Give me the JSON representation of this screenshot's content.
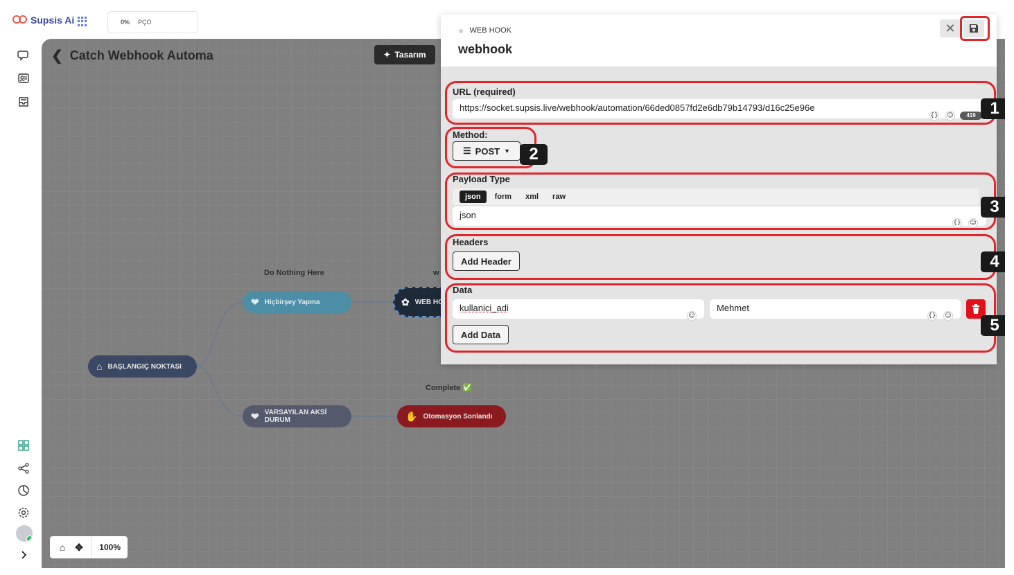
{
  "app": {
    "logo_text": "Supsis Ai",
    "progress_percent": "0%",
    "progress_label": "PÇO"
  },
  "canvas": {
    "title": "Catch Webhook Automa",
    "design_button": "Tasarım",
    "zoom": "100%",
    "nodes": {
      "start": "BAŞLANGIÇ NOKTASI",
      "nothing": "Hiçbirşey Yapma",
      "webhook": "WEB HO",
      "default": "VARSAYILAN AKSİ DURUM",
      "end": "Otomasyon Sonlandı"
    },
    "labels": {
      "do_nothing": "Do Nothing Here",
      "webhook_partial": "w",
      "complete": "Complete ✅"
    }
  },
  "panel": {
    "type_label": "WEB HOOK",
    "name": "webhook",
    "url": {
      "title": "URL (required)",
      "value": "https://socket.supsis.live/webhook/automation/66ded0857fd2e6db79b14793/d16c25e96e",
      "count": "419"
    },
    "method": {
      "title": "Method:",
      "value": "POST"
    },
    "payload": {
      "title": "Payload Type",
      "tabs": [
        "json",
        "form",
        "xml",
        "raw"
      ],
      "active_tab": "json",
      "value": "json"
    },
    "headers": {
      "title": "Headers",
      "add_button": "Add Header"
    },
    "data": {
      "title": "Data",
      "key": "kullanici_adi",
      "value": "Mehmet",
      "add_button": "Add Data"
    },
    "step_numbers": [
      "1",
      "2",
      "3",
      "4",
      "5"
    ]
  },
  "colors": {
    "highlight": "#e0262a",
    "canvas_bg": "#808080",
    "start_node": "#3b4863",
    "nothing_node": "#4c8ea6",
    "default_node": "#545a6b",
    "end_node": "#8a1a1f"
  }
}
